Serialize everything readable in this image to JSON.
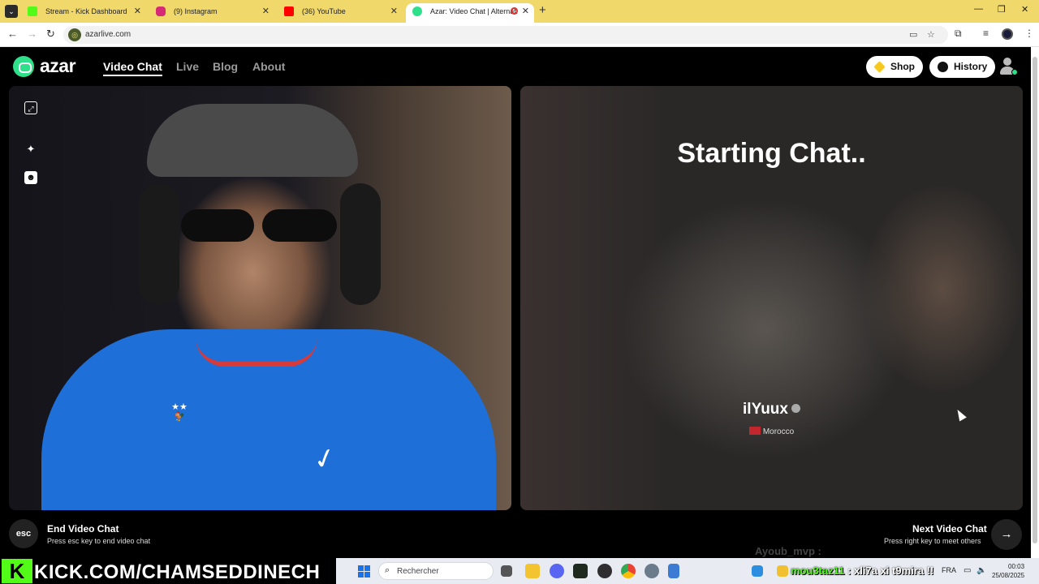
{
  "browser": {
    "tabs": [
      {
        "title": "Stream - Kick Dashboard",
        "color": "#53fc18"
      },
      {
        "title": "(9) Instagram",
        "color": "#d62976"
      },
      {
        "title": "(36) YouTube",
        "color": "#ff0000"
      },
      {
        "title": "Azar: Video Chat | Alternati",
        "color": "#2ee08a",
        "active": true
      }
    ],
    "url": "azarlive.com"
  },
  "azar": {
    "logo_text": "azar",
    "nav": [
      "Video Chat",
      "Live",
      "Blog",
      "About"
    ],
    "shop_label": "Shop",
    "history_label": "History",
    "remote": {
      "status": "Starting Chat..",
      "peer_name": "ilYuux",
      "peer_country": "Morocco"
    },
    "controls": {
      "esc_key": "esc",
      "end_title": "End Video Chat",
      "end_sub": "Press esc key to end video chat",
      "next_title": "Next Video Chat",
      "next_sub": "Press right key to meet others"
    },
    "chat_ghost": "Ayoub_mvp :",
    "accent": "#2ee08a"
  },
  "stream_overlay": {
    "kick_letter": "K",
    "banner_text": "KICK.COM/CHAMSEDDINECH",
    "chat_user": "mou3taz11",
    "chat_message": ": xli7a xi t9mira !!"
  },
  "taskbar": {
    "search_placeholder": "Rechercher",
    "lang": "FRA",
    "time": "00:03",
    "date": "25/08/2025"
  }
}
